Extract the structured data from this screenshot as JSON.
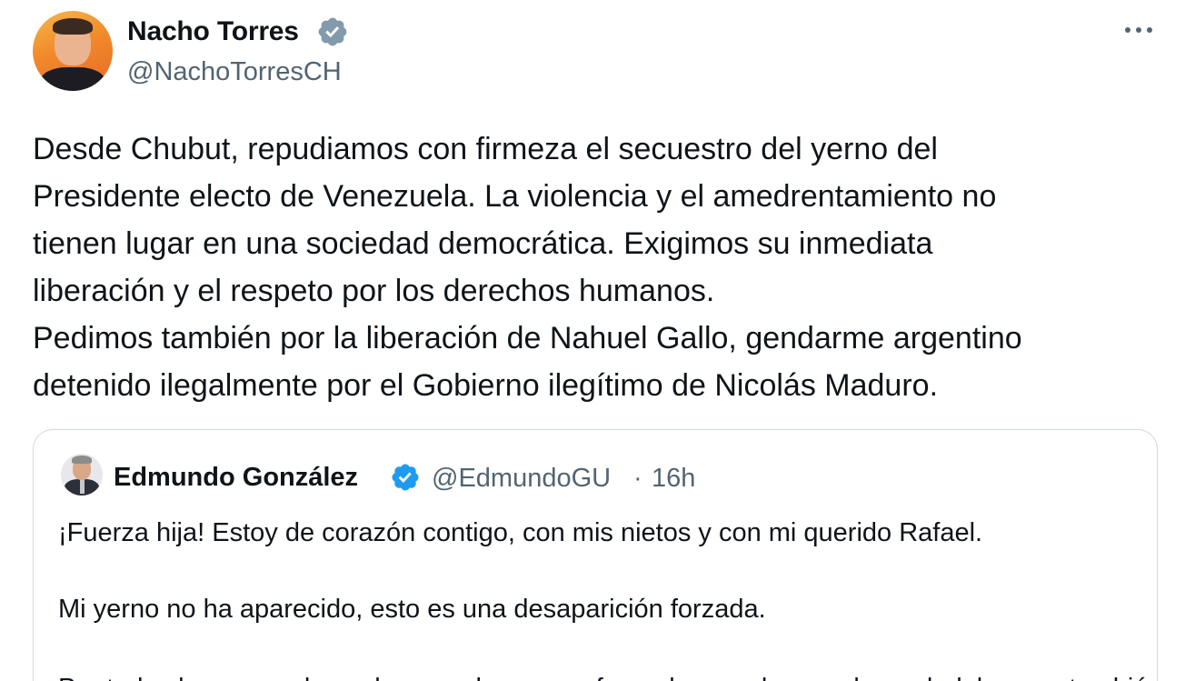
{
  "tweet": {
    "author": {
      "name": "Nacho Torres",
      "handle": "@NachoTorresCH",
      "verified": true
    },
    "more_icon": "more-horizontal-icon",
    "body_lines": [
      "Desde Chubut, repudiamos con firmeza el secuestro del yerno del",
      "Presidente electo de Venezuela. La violencia y el amedrentamiento no",
      "tienen lugar en una sociedad democrática. Exigimos su inmediata",
      "liberación y el respeto por los derechos humanos.",
      "Pedimos también por la liberación de Nahuel Gallo, gendarme argentino",
      "detenido ilegalmente por el Gobierno ilegítimo de Nicolás Maduro."
    ],
    "quoted": {
      "author": {
        "name": "Edmundo González",
        "handle": "@EdmundoGU",
        "separator": "·",
        "time": "16h",
        "verified": true
      },
      "lines": [
        "¡Fuerza hija! Estoy de corazón contigo, con mis nietos y con mi querido Rafael.",
        "Mi yerno no ha aparecido, esto es una desaparición forzada.",
        "Por todos los venezolanos buenos, los que sufren y los que buscan la verdad, los que también"
      ]
    }
  },
  "colors": {
    "verified_blue": "#1d9bf0",
    "verified_gray": "#829aab",
    "secondary_text": "#536471",
    "border": "#cfd9de"
  }
}
